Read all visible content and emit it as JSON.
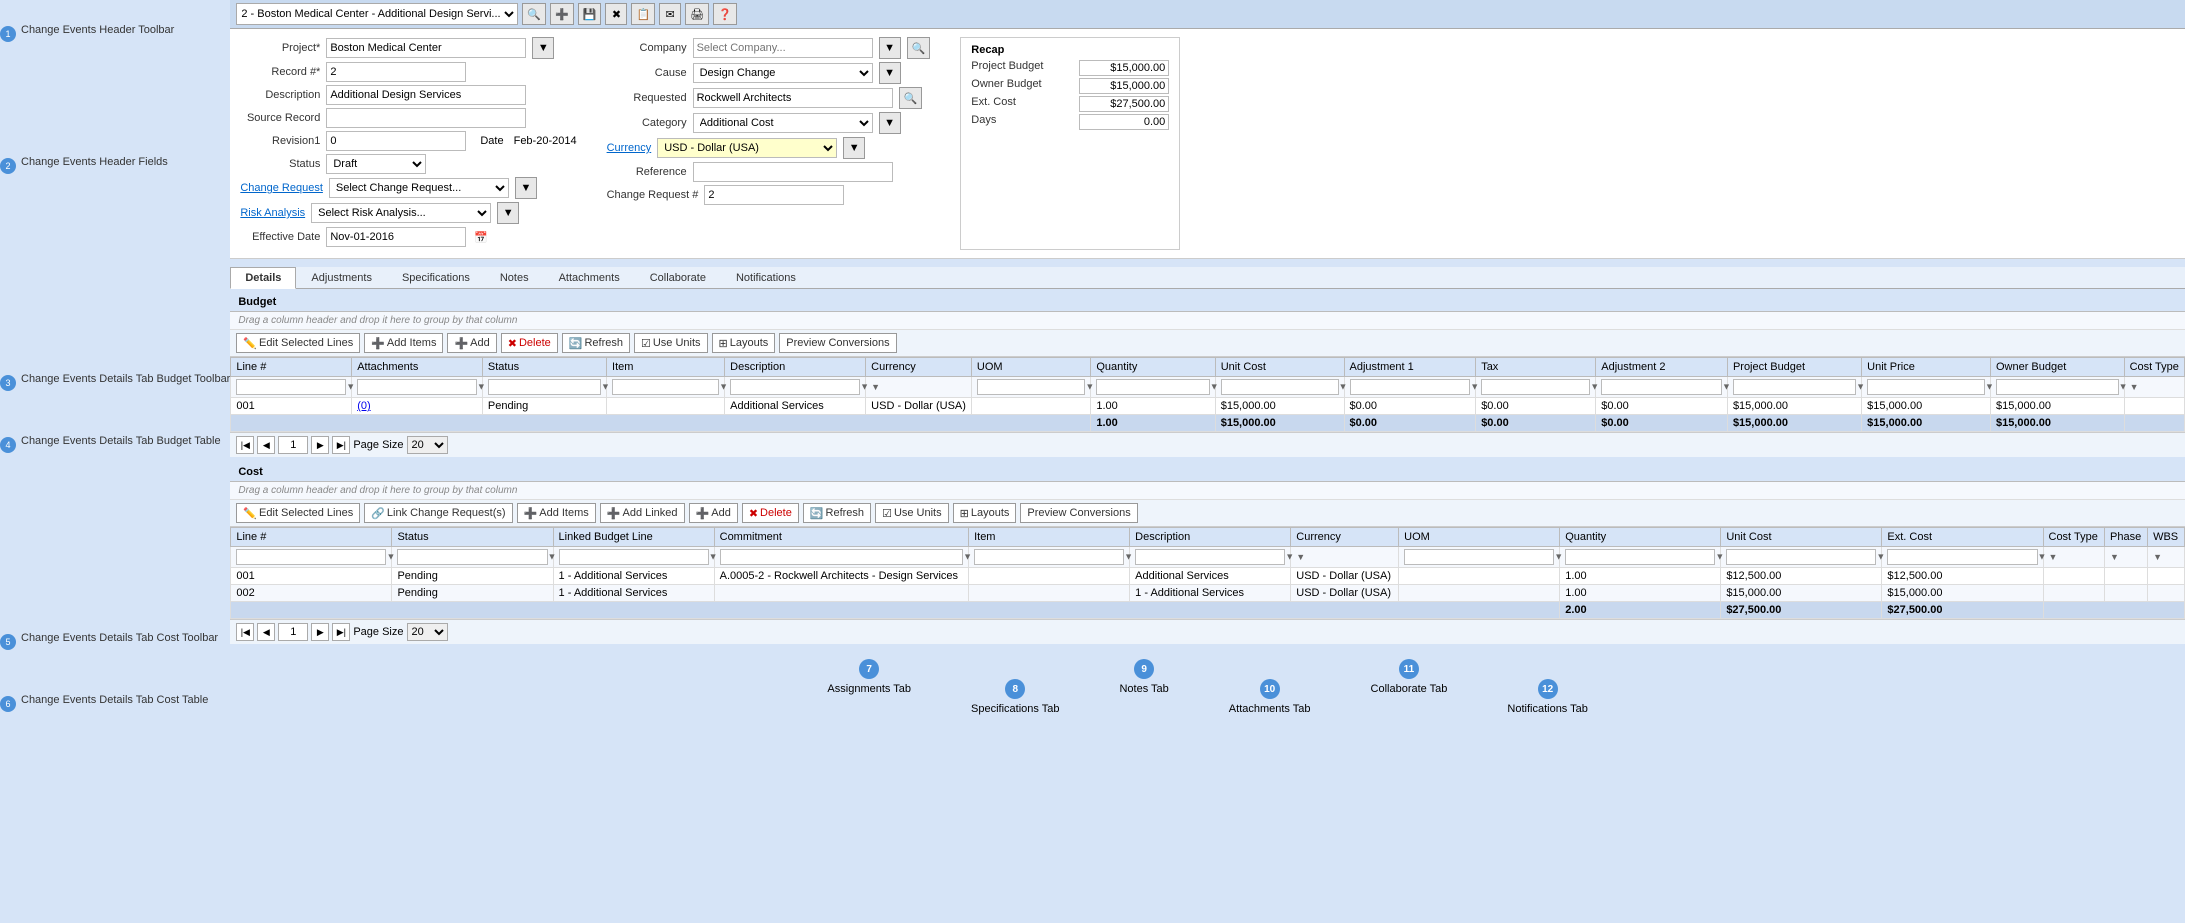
{
  "toolbar": {
    "title": "Change Events Header Toolbar",
    "badge": "1",
    "dropdown_value": "2 - Boston Medical Center - Additional Design Servi...",
    "buttons": [
      "new",
      "save",
      "delete",
      "copy",
      "email",
      "print",
      "help"
    ]
  },
  "header_fields": {
    "title": "Change Events Header Fields",
    "badge": "2",
    "project_label": "Project*",
    "project_value": "Boston Medical Center",
    "record_label": "Record #*",
    "record_value": "2",
    "description_label": "Description",
    "description_value": "Additional Design Services",
    "source_record_label": "Source Record",
    "revision_label": "Revision1",
    "revision_value": "0",
    "date_label": "Date",
    "date_value": "Feb-20-2014",
    "status_label": "Status",
    "status_value": "Draft",
    "change_request_label": "Change Request",
    "change_request_placeholder": "Select Change Request...",
    "risk_analysis_label": "Risk Analysis",
    "risk_analysis_placeholder": "Select Risk Analysis...",
    "effective_date_label": "Effective Date",
    "effective_date_value": "Nov-01-2016",
    "company_label": "Company",
    "company_placeholder": "Select Company...",
    "cause_label": "Cause",
    "cause_value": "Design Change",
    "requested_label": "Requested",
    "requested_value": "Rockwell Architects",
    "category_label": "Category",
    "category_value": "Additional Cost",
    "currency_label": "Currency",
    "currency_value": "USD - Dollar (USA)",
    "reference_label": "Reference",
    "reference_value": "",
    "change_request_num_label": "Change Request #",
    "change_request_num_value": "2"
  },
  "recap": {
    "title": "Recap",
    "project_budget_label": "Project Budget",
    "project_budget_value": "$15,000.00",
    "owner_budget_label": "Owner Budget",
    "owner_budget_value": "$15,000.00",
    "ext_cost_label": "Ext. Cost",
    "ext_cost_value": "$27,500.00",
    "days_label": "Days",
    "days_value": "0.00"
  },
  "tabs": [
    "Details",
    "Adjustments",
    "Specifications",
    "Notes",
    "Attachments",
    "Collaborate",
    "Notifications"
  ],
  "active_tab": "Details",
  "budget": {
    "section_title": "Budget",
    "drag_hint": "Drag a column header and drop it here to group by that column",
    "toolbar_badge": "3",
    "toolbar_title": "Change Events Details Tab Budget Toolbar",
    "table_badge": "4",
    "table_title": "Change Events Details Tab Budget Table",
    "buttons": {
      "edit_selected": "Edit Selected Lines",
      "add_items": "Add Items",
      "add": "Add",
      "delete": "Delete",
      "refresh": "Refresh",
      "use_units": "Use Units",
      "layouts": "Layouts",
      "preview_conversions": "Preview Conversions"
    },
    "columns": [
      "Line #",
      "Attachments",
      "Status",
      "Item",
      "Description",
      "Currency",
      "UOM",
      "Quantity",
      "Unit Cost",
      "Adjustment 1",
      "Tax",
      "Adjustment 2",
      "Project Budget",
      "Unit Price",
      "Owner Budget",
      "Cost Type"
    ],
    "rows": [
      {
        "line": "001",
        "attachments": "(0)",
        "status": "Pending",
        "item": "",
        "description": "Additional Services",
        "currency": "USD - Dollar (USA)",
        "uom": "",
        "quantity": "1.00",
        "unit_cost": "$15,000.00",
        "adj1": "$0.00",
        "tax": "$0.00",
        "adj2": "$0.00",
        "project_budget": "$15,000.00",
        "unit_price": "$15,000.00",
        "owner_budget": "$15,000.00",
        "cost_type": ""
      }
    ],
    "total_row": {
      "quantity": "1.00",
      "unit_cost": "$15,000.00",
      "adj1": "$0.00",
      "tax": "$0.00",
      "adj2": "$0.00",
      "project_budget": "$15,000.00",
      "unit_price": "$15,000.00",
      "owner_budget": "$15,000.00"
    },
    "pagination": {
      "page": "1",
      "page_size": "20"
    }
  },
  "cost": {
    "section_title": "Cost",
    "drag_hint": "Drag a column header and drop it here to group by that column",
    "toolbar_badge": "5",
    "toolbar_title": "Change Events Details Tab Cost Toolbar",
    "table_badge": "6",
    "table_title": "Change Events Details Tab Cost Table",
    "buttons": {
      "edit_selected": "Edit Selected Lines",
      "link_change_requests": "Link Change Request(s)",
      "add_items": "Add Items",
      "add_linked": "Add Linked",
      "add": "Add",
      "delete": "Delete",
      "refresh": "Refresh",
      "use_units": "Use Units",
      "layouts": "Layouts",
      "preview_conversions": "Preview Conversions"
    },
    "columns": [
      "Line #",
      "Status",
      "Linked Budget Line",
      "Commitment",
      "Item",
      "Description",
      "Currency",
      "UOM",
      "Quantity",
      "Unit Cost",
      "Ext. Cost",
      "Cost Type",
      "Phase",
      "WBS"
    ],
    "rows": [
      {
        "line": "001",
        "status": "Pending",
        "linked_budget": "1 - Additional Services",
        "commitment": "A.0005-2 - Rockwell Architects - Design Services",
        "item": "",
        "description": "Additional Services",
        "currency": "USD - Dollar (USA)",
        "uom": "",
        "quantity": "1.00",
        "unit_cost": "$12,500.00",
        "ext_cost": "$12,500.00",
        "cost_type": "",
        "phase": "",
        "wbs": ""
      },
      {
        "line": "002",
        "status": "Pending",
        "linked_budget": "1 - Additional Services",
        "commitment": "",
        "item": "",
        "description": "1 - Additional Services",
        "currency": "USD - Dollar (USA)",
        "uom": "",
        "quantity": "1.00",
        "unit_cost": "$15,000.00",
        "ext_cost": "$15,000.00",
        "cost_type": "",
        "phase": "",
        "wbs": ""
      }
    ],
    "total_row": {
      "quantity": "2.00",
      "unit_cost": "$27,500.00",
      "ext_cost": "$27,500.00"
    },
    "pagination": {
      "page": "1",
      "page_size": "20"
    }
  },
  "bottom_callouts": [
    {
      "badge": "7",
      "label": "Assignments Tab",
      "offset": "top"
    },
    {
      "badge": "8",
      "label": "Specifications Tab",
      "offset": "bottom"
    },
    {
      "badge": "9",
      "label": "Notes Tab",
      "offset": "top"
    },
    {
      "badge": "10",
      "label": "Attachments Tab",
      "offset": "bottom"
    },
    {
      "badge": "11",
      "label": "Collaborate Tab",
      "offset": "top"
    },
    {
      "badge": "12",
      "label": "Notifications Tab",
      "offset": "bottom"
    }
  ]
}
